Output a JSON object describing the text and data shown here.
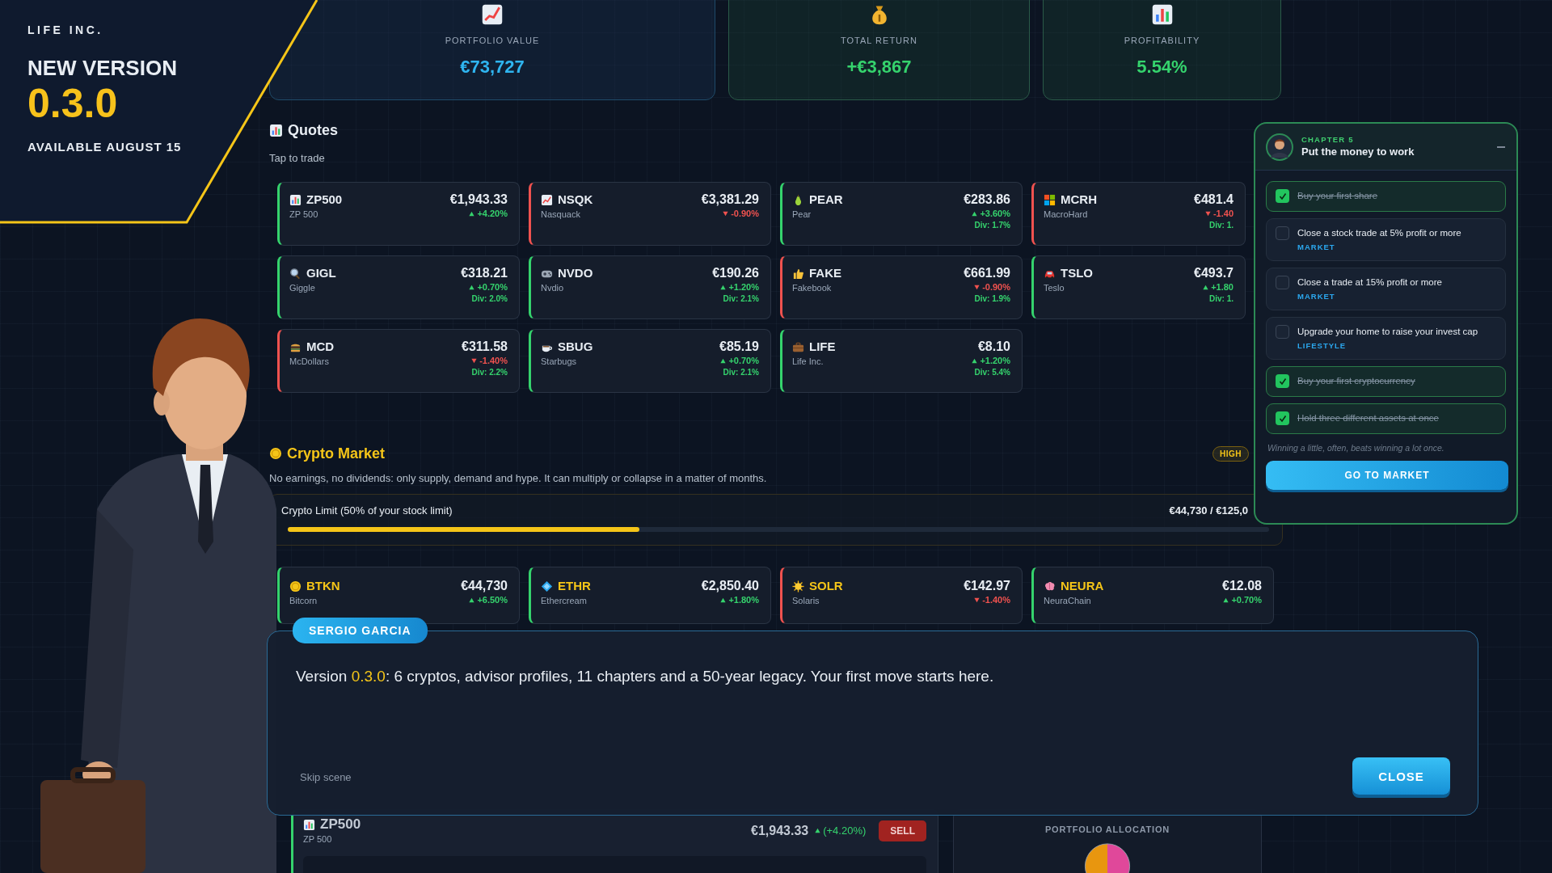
{
  "banner": {
    "brand": "LIFE INC.",
    "heading": "NEW VERSION",
    "version": "0.3.0",
    "availability": "AVAILABLE AUGUST 15"
  },
  "stats": [
    {
      "kind": "value",
      "label": "PORTFOLIO VALUE",
      "value": "€73,727"
    },
    {
      "kind": "return",
      "label": "TOTAL RETURN",
      "value": "+€3,867"
    },
    {
      "kind": "profitability",
      "label": "PROFITABILITY",
      "value": "5.54%"
    }
  ],
  "quotes": {
    "title": "Quotes",
    "subtitle": "Tap to trade",
    "items": [
      {
        "symbol": "ZP500",
        "name": "ZP 500",
        "price": "€1,943.33",
        "change": "+4.20%",
        "rising": true
      },
      {
        "symbol": "NSQK",
        "name": "Nasquack",
        "price": "€3,381.29",
        "change": "-0.90%",
        "rising": false
      },
      {
        "symbol": "PEAR",
        "name": "Pear",
        "price": "€283.86",
        "change": "+3.60%",
        "rising": true,
        "dividend": "Div: 1.7%"
      },
      {
        "symbol": "MCRH",
        "name": "MacroHard",
        "price": "€481.4",
        "change": "-1.40",
        "rising": false,
        "dividend": "Div: 1."
      },
      {
        "symbol": "GIGL",
        "name": "Giggle",
        "price": "€318.21",
        "change": "+0.70%",
        "rising": true,
        "dividend": "Div: 2.0%"
      },
      {
        "symbol": "NVDO",
        "name": "Nvdio",
        "price": "€190.26",
        "change": "+1.20%",
        "rising": true,
        "dividend": "Div: 2.1%"
      },
      {
        "symbol": "FAKE",
        "name": "Fakebook",
        "price": "€661.99",
        "change": "-0.90%",
        "rising": false,
        "dividend": "Div: 1.9%"
      },
      {
        "symbol": "TSLO",
        "name": "Teslo",
        "price": "€493.7",
        "change": "+1.80",
        "rising": true,
        "dividend": "Div: 1."
      },
      {
        "symbol": "MCD",
        "name": "McDollars",
        "price": "€311.58",
        "change": "-1.40%",
        "rising": false,
        "dividend": "Div: 2.2%"
      },
      {
        "symbol": "SBUG",
        "name": "Starbugs",
        "price": "€85.19",
        "change": "+0.70%",
        "rising": true,
        "dividend": "Div: 2.1%"
      },
      {
        "symbol": "LIFE",
        "name": "Life Inc.",
        "price": "€8.10",
        "change": "+1.20%",
        "rising": true,
        "dividend": "Div: 5.4%"
      }
    ]
  },
  "crypto": {
    "title": "Crypto Market",
    "risk_badge": "HIGH",
    "description": "No earnings, no dividends: only supply, demand and hype. It can multiply or collapse in a matter of months.",
    "limit": {
      "label": "Crypto Limit (50% of your stock limit)",
      "reading": "€44,730 / €125,0",
      "level": 0.358
    },
    "coins": [
      {
        "symbol": "BTKN",
        "name": "Bitcorn",
        "price": "€44,730",
        "change": "+6.50%",
        "rising": true
      },
      {
        "symbol": "ETHR",
        "name": "Ethercream",
        "price": "€2,850.40",
        "change": "+1.80%",
        "rising": true
      },
      {
        "symbol": "SOLR",
        "name": "Solaris",
        "price": "€142.97",
        "change": "-1.40%",
        "rising": false
      },
      {
        "symbol": "NEURA",
        "name": "NeuraChain",
        "price": "€12.08",
        "change": "+0.70%",
        "rising": true
      }
    ]
  },
  "positions": {
    "items": [
      {
        "symbol": "ZP500",
        "name": "ZP 500",
        "price": "€1,943.33",
        "change": "(+4.20%)",
        "rising": true,
        "action": "SELL"
      }
    ],
    "allocation": {
      "title": "PORTFOLIO ALLOCATION"
    }
  },
  "chapter": {
    "chapter": "CHAPTER 5",
    "title": "Put the money to work",
    "tasks": [
      {
        "text": "Buy your first share",
        "checked": true
      },
      {
        "text": "Close a stock trade at 5% profit or more",
        "checked": false,
        "tag": "MARKET"
      },
      {
        "text": "Close a trade at 15% profit or more",
        "checked": false,
        "tag": "MARKET"
      },
      {
        "text": "Upgrade your home to raise your invest cap",
        "checked": false,
        "tag": "LIFESTYLE"
      },
      {
        "text": "Buy your first cryptocurrency",
        "checked": true
      },
      {
        "text": "Hold three different assets at once",
        "checked": true
      }
    ],
    "quote": "Winning a little, often, beats winning a lot once.",
    "button": "GO TO MARKET"
  },
  "dialog": {
    "speaker": "SERGIO GARCIA",
    "text": "Version **0.3.0**: 6 cryptos, advisor profiles, 11 chapters and a 50-year legacy. Your first move starts here.",
    "skip": "Skip scene",
    "button": "CLOSE"
  }
}
